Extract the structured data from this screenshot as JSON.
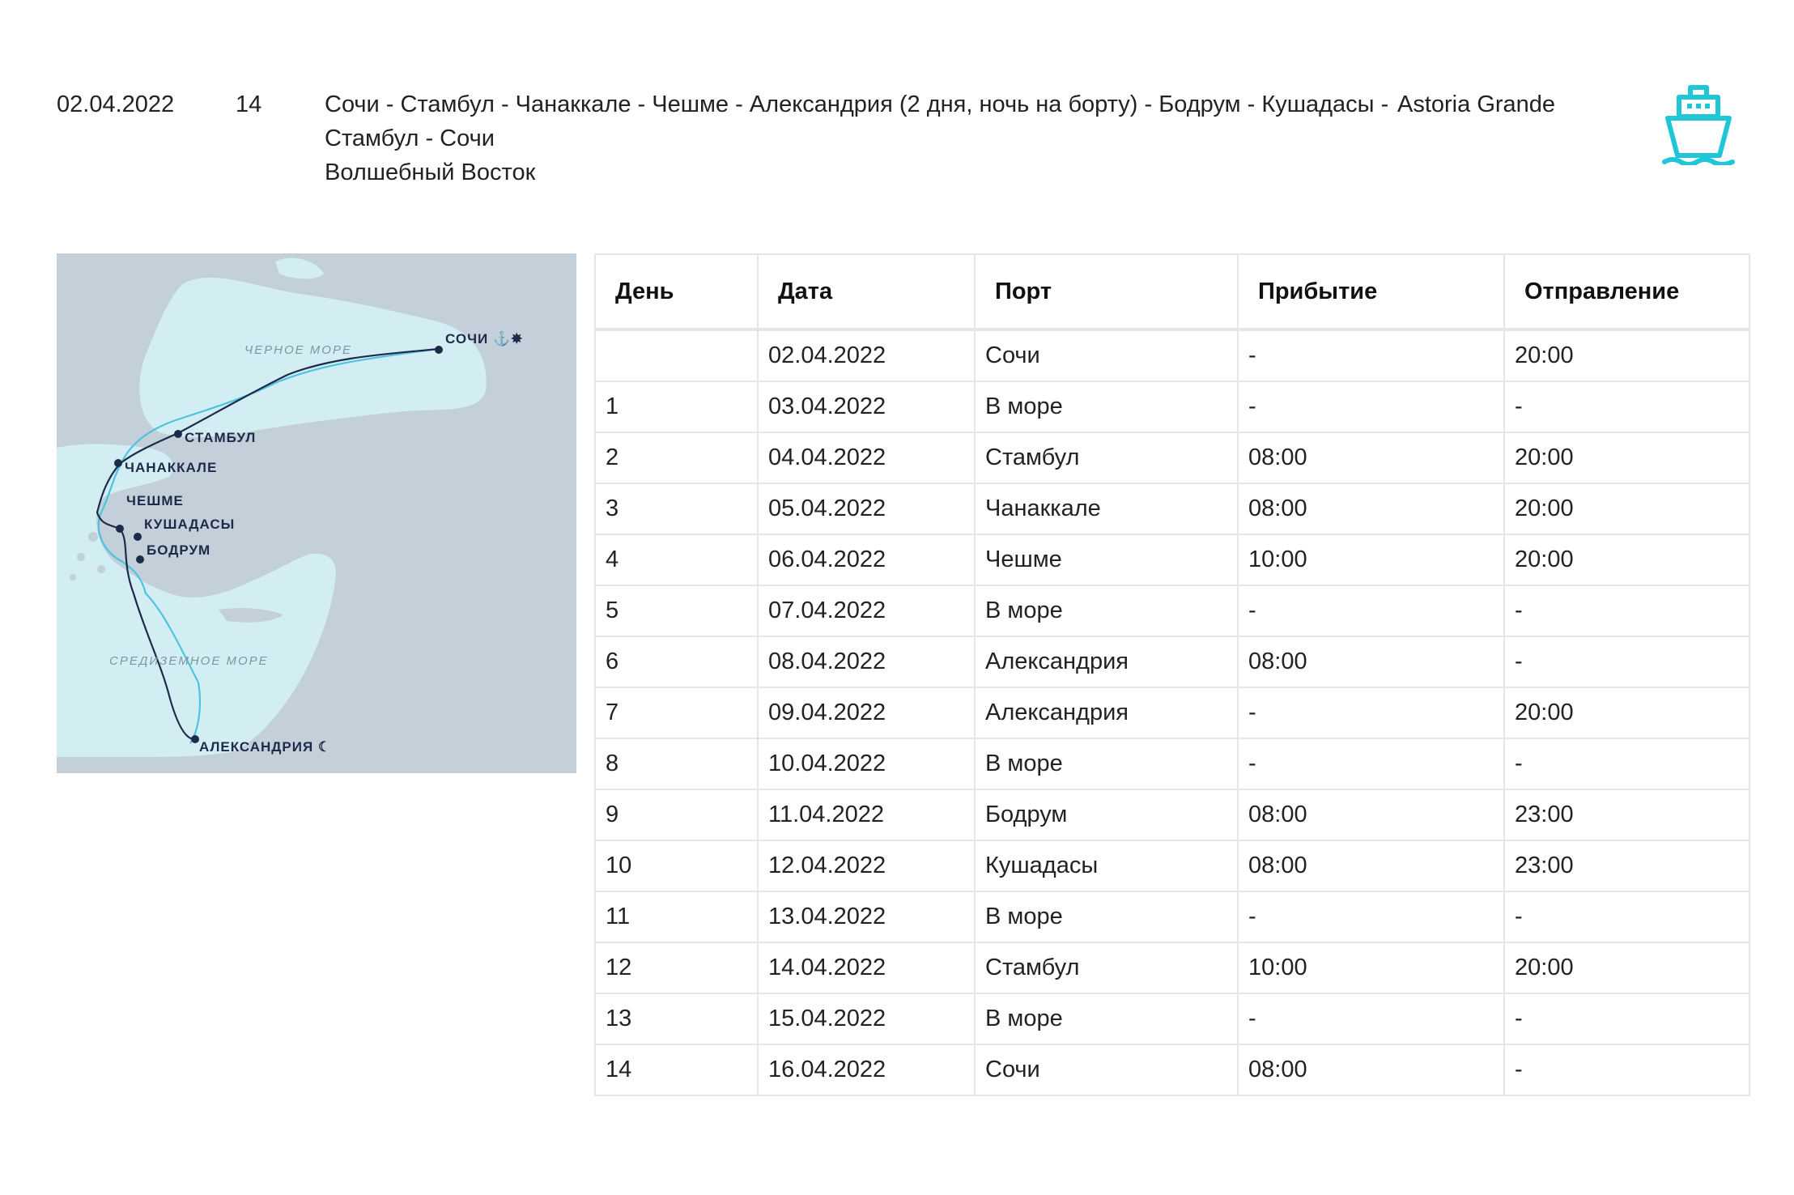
{
  "header": {
    "date": "02.04.2022",
    "nights": "14",
    "route": "Сочи - Стамбул - Чанаккале - Чешме - Александрия (2 дня, ночь на борту) - Бодрум - Кушадасы - Стамбул - Сочи",
    "cruise_name": "Волшебный Восток",
    "ship": "Astoria Grande",
    "ship_icon": "ship-icon",
    "accent_color": "#20c5d8"
  },
  "map": {
    "colors": {
      "sea": "#d3eef3",
      "land": "#c3cfd9",
      "route_out": "#1e2a4a",
      "route_back": "#4cc3df"
    },
    "seas": [
      "ЧЕРНОЕ МОРЕ",
      "СРЕДИЗЕМНОЕ МОРЕ"
    ],
    "ports": [
      {
        "label": "СОЧИ",
        "marker": "⚓✸"
      },
      {
        "label": "СТАМБУЛ",
        "marker": ""
      },
      {
        "label": "ЧАНАККАЛЕ",
        "marker": ""
      },
      {
        "label": "ЧЕШМЕ",
        "marker": ""
      },
      {
        "label": "КУШАДАСЫ",
        "marker": ""
      },
      {
        "label": "БОДРУМ",
        "marker": ""
      },
      {
        "label": "АЛЕКСАНДРИЯ",
        "marker": "☾"
      }
    ]
  },
  "table": {
    "headers": [
      "День",
      "Дата",
      "Порт",
      "Прибытие",
      "Отправление"
    ],
    "rows": [
      [
        "",
        "02.04.2022",
        "Сочи",
        "-",
        "20:00"
      ],
      [
        "1",
        "03.04.2022",
        "В море",
        "-",
        "-"
      ],
      [
        "2",
        "04.04.2022",
        "Стамбул",
        "08:00",
        "20:00"
      ],
      [
        "3",
        "05.04.2022",
        "Чанаккале",
        "08:00",
        "20:00"
      ],
      [
        "4",
        "06.04.2022",
        "Чешме",
        "10:00",
        "20:00"
      ],
      [
        "5",
        "07.04.2022",
        "В море",
        "-",
        "-"
      ],
      [
        "6",
        "08.04.2022",
        "Александрия",
        "08:00",
        "-"
      ],
      [
        "7",
        "09.04.2022",
        "Александрия",
        "-",
        "20:00"
      ],
      [
        "8",
        "10.04.2022",
        "В море",
        "-",
        "-"
      ],
      [
        "9",
        "11.04.2022",
        "Бодрум",
        "08:00",
        "23:00"
      ],
      [
        "10",
        "12.04.2022",
        "Кушадасы",
        "08:00",
        "23:00"
      ],
      [
        "11",
        "13.04.2022",
        "В море",
        "-",
        "-"
      ],
      [
        "12",
        "14.04.2022",
        "Стамбул",
        "10:00",
        "20:00"
      ],
      [
        "13",
        "15.04.2022",
        "В море",
        "-",
        "-"
      ],
      [
        "14",
        "16.04.2022",
        "Сочи",
        "08:00",
        "-"
      ]
    ]
  }
}
